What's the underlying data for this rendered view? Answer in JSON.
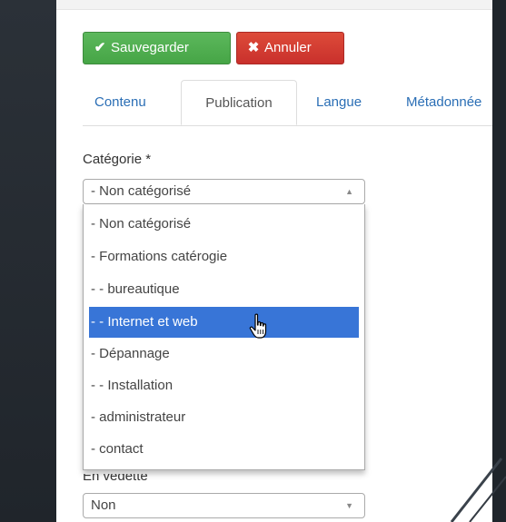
{
  "toolbar": {
    "save_label": "Sauvegarder",
    "cancel_label": "Annuler"
  },
  "tabs": [
    {
      "label": "Contenu"
    },
    {
      "label": "Publication"
    },
    {
      "label": "Langue"
    },
    {
      "label": "Métadonnée"
    }
  ],
  "active_tab": "Publication",
  "category": {
    "label": "Catégorie *",
    "selected": "- Non catégorisé",
    "options": [
      "- Non catégorisé",
      "- Formations catérogie",
      "- - bureautique",
      "- - Internet et web",
      "- Dépannage",
      "- - Installation",
      "- administrateur",
      "- contact"
    ],
    "highlighted": "- - Internet et web"
  },
  "featured": {
    "label": "En vedette",
    "selected": "Non"
  },
  "colors": {
    "save": "#5cb85c",
    "cancel": "#d9534f",
    "highlight": "#3875d7",
    "link": "#2a6eb5"
  },
  "icons": {
    "save": "check-icon",
    "cancel": "x-icon",
    "select": "caret-icon",
    "cursor": "hand-pointer-icon"
  }
}
